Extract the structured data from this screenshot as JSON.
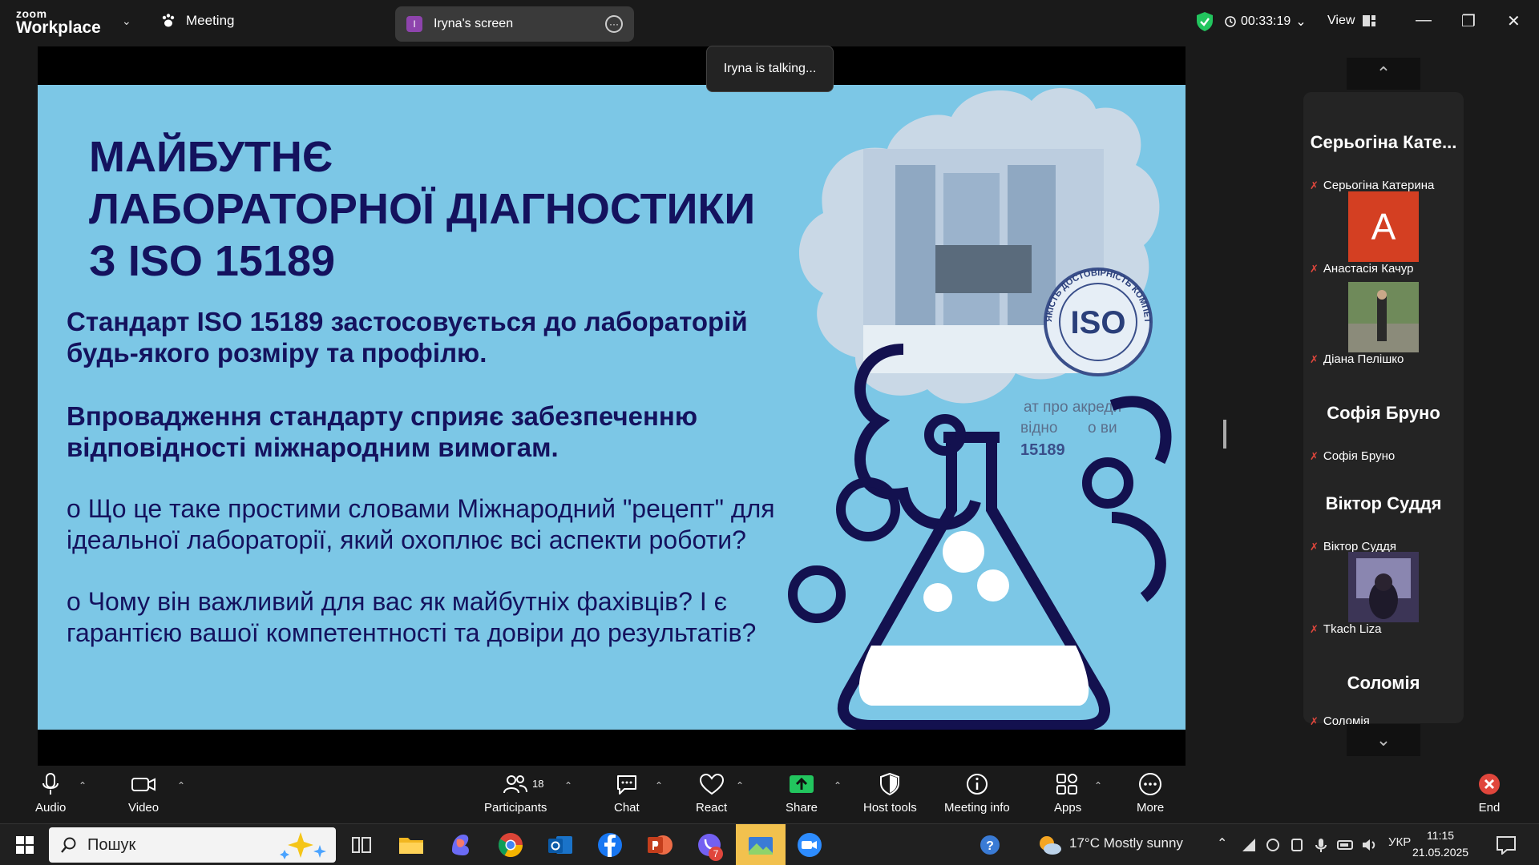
{
  "titlebar": {
    "logo_line1": "zoom",
    "logo_line2": "Workplace",
    "meeting_label": "Meeting",
    "shared_screen_badge": "I",
    "shared_screen_label": "Iryna's screen",
    "timer": "00:33:19",
    "view_label": "View"
  },
  "talking_indicator": "Iryna is talking...",
  "slide": {
    "title_line1": "МАЙБУТНЄ",
    "title_line2": "ЛАБОРАТОРНОЇ ДІАГНОСТИКИ",
    "title_line3": "З ISO 15189",
    "para1": "Стандарт ISO 15189 застосовується до лабораторій будь-якого розміру та профілю.",
    "para2": "Впровадження стандарту сприяє забезпеченню відповідності міжнародним вимогам.",
    "bullet1": "о     Що це таке простими словами Міжнародний \"рецепт\" для ідеальної лабораторії, який охоплює всі аспекти роботи?",
    "bullet2": "о     Чому він важливий для вас як майбутніх фахівців? І є гарантією вашої компетентності та довіри до результатів?",
    "stamp_text": "ISO",
    "stamp_ring": "ЯКІСТЬ ДОСТОВІРНІСТЬ КОМПЕТЕНТНІСТЬ",
    "overlay_text1": "ат про акреди",
    "overlay_text2": "відно",
    "overlay_text3": "о ви",
    "overlay_text4": "15189"
  },
  "participants": [
    {
      "big": "Серьогіна Кате...",
      "name": "Серьогіна Катерина",
      "type": "name"
    },
    {
      "avatar_letter": "А",
      "name": "Анастасія Качур",
      "type": "letter",
      "color": "#d43f22"
    },
    {
      "name": "Діана Пелішко",
      "type": "photo"
    },
    {
      "big": "Софія Бруно",
      "name": "Софія Бруно",
      "type": "name"
    },
    {
      "big": "Віктор Суддя",
      "name": "Віктор Суддя",
      "type": "name"
    },
    {
      "name": "Tkach Liza",
      "type": "photo"
    },
    {
      "big": "Соломія",
      "name": "Соломія",
      "type": "name"
    }
  ],
  "toolbar": {
    "audio": "Audio",
    "video": "Video",
    "participants": "Participants",
    "participants_count": "18",
    "chat": "Chat",
    "react": "React",
    "share": "Share",
    "host_tools": "Host tools",
    "meeting_info": "Meeting info",
    "apps": "Apps",
    "more": "More",
    "end": "End"
  },
  "taskbar": {
    "search_placeholder": "Пошук",
    "weather": "17°C  Mostly sunny",
    "language": "УКР",
    "time": "11:15",
    "date": "21.05.2025",
    "badge_count": "7"
  },
  "colors": {
    "slide_bg": "#7cc7e6",
    "slide_text": "#14125e",
    "share_green": "#22c55e",
    "end_red": "#e0463c"
  }
}
